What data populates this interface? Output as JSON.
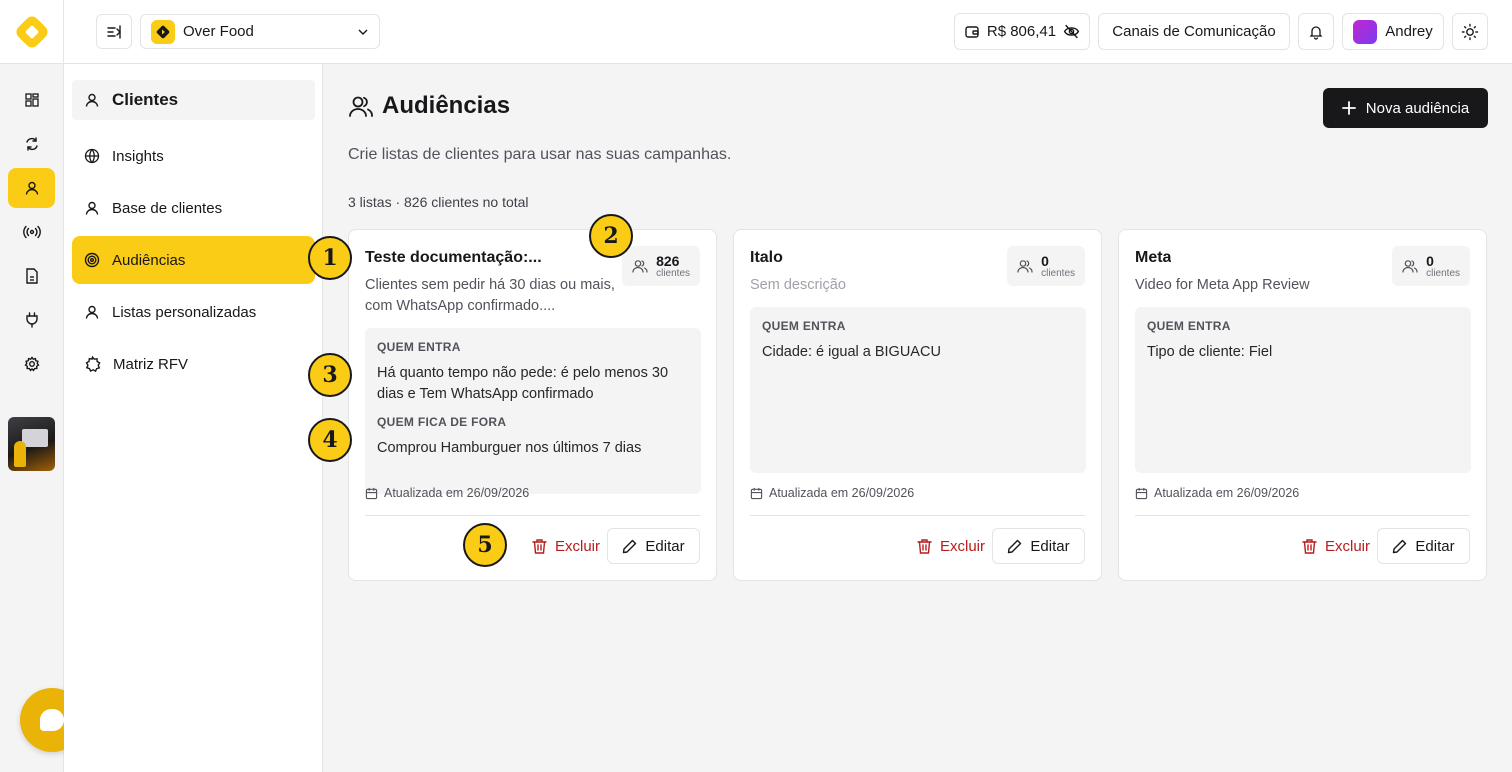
{
  "header": {
    "store_name": "Over Food",
    "balance": "R$ 806,41",
    "channels_label": "Canais de Comunicação",
    "user_name": "Andrey"
  },
  "sidebar": {
    "section_title": "Clientes",
    "items": [
      {
        "label": "Insights",
        "icon": "globe-icon"
      },
      {
        "label": "Base de clientes",
        "icon": "user-icon"
      },
      {
        "label": "Audiências",
        "icon": "target-icon",
        "active": true
      },
      {
        "label": "Listas personalizadas",
        "icon": "user-icon"
      },
      {
        "label": "Matriz RFV",
        "icon": "star-badge-icon"
      }
    ]
  },
  "main": {
    "title": "Audiências",
    "new_button": "Nova audiência",
    "subtitle": "Crie listas de clientes para usar nas suas campanhas.",
    "summary": "3 listas · 826 clientes no total",
    "cards": [
      {
        "title": "Teste documentação:...",
        "description": "Clientes sem pedir há 30 dias ou mais, com WhatsApp confirmado....",
        "count": "826",
        "count_label": "clientes",
        "include_heading": "QUEM ENTRA",
        "include_text": "Há quanto tempo não pede: é pelo menos 30 dias e Tem WhatsApp confirmado",
        "exclude_heading": "QUEM FICA DE FORA",
        "exclude_text": "Comprou Hamburguer nos últimos 7 dias",
        "updated": "Atualizada em 26/09/2026",
        "delete_label": "Excluir",
        "edit_label": "Editar"
      },
      {
        "title": "Italo",
        "description": "Sem descrição",
        "count": "0",
        "count_label": "clientes",
        "include_heading": "QUEM ENTRA",
        "include_text": "Cidade: é igual a BIGUACU",
        "updated": "Atualizada em 26/09/2026",
        "delete_label": "Excluir",
        "edit_label": "Editar"
      },
      {
        "title": "Meta",
        "description": "Video for Meta App Review",
        "count": "0",
        "count_label": "clientes",
        "include_heading": "QUEM ENTRA",
        "include_text": "Tipo de cliente: Fiel",
        "updated": "Atualizada em 26/09/2026",
        "delete_label": "Excluir",
        "edit_label": "Editar"
      }
    ]
  },
  "callouts": [
    "1",
    "2",
    "3",
    "4",
    "5"
  ],
  "colors": {
    "accent": "#facc15",
    "danger": "#b91c1c",
    "dark": "#18181b"
  }
}
